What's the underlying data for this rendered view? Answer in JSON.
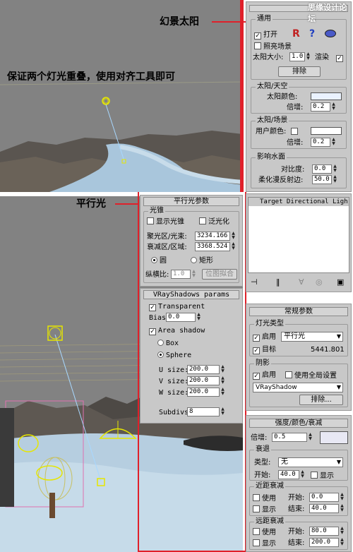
{
  "watermark": "思缘设计论坛",
  "callouts": {
    "sun": "幻景太阳",
    "align_note": "保证两个灯光重叠，使用对齐工具即可",
    "parallel": "平行光"
  },
  "sun_panel": {
    "common_title": "通用",
    "on_label": "打开",
    "exclude_lighting": "照亮场景",
    "sun_size_label": "太阳大小:",
    "sun_size_value": "1.0",
    "render_label": "渲染",
    "exclude_button": "排除",
    "sky_title": "太阳/天空",
    "sun_color_label": "太阳颜色:",
    "mult_label": "倍增:",
    "sun_mult": "0.2",
    "scene_title": "太阳/场景",
    "user_color_label": "用户颜色:",
    "scene_mult": "0.2",
    "water_title": "影响水面",
    "contrast_label": "对比度:",
    "contrast_value": "0.0",
    "diffuse_label": "柔化漫反射边:",
    "diffuse_value": "50.0"
  },
  "directional_panel": {
    "title": "平行光参数",
    "cone_group": "光锥",
    "show_cone": "显示光锥",
    "overshoot": "泛光化",
    "hotspot_label": "聚光区/光束:",
    "hotspot_value": "3234.166",
    "falloff_label": "衰减区/区域:",
    "falloff_value": "3368.524",
    "circle": "圆",
    "rect": "矩形",
    "aspect_label": "纵横比:",
    "aspect_value": "1.0",
    "bitmap_fit": "位图拟合"
  },
  "vray_panel": {
    "title": "VRayShadows params",
    "transparent": "Transparent",
    "bias_label": "Bias:",
    "bias_value": "0.0",
    "area_shadow": "Area shadow",
    "box": "Box",
    "sphere": "Sphere",
    "usize_label": "U size:",
    "usize": "200.0",
    "vsize_label": "V size:",
    "vsize": "200.0",
    "wsize_label": "W size:",
    "wsize": "200.0",
    "subdivs_label": "Subdivs:",
    "subdivs": "8"
  },
  "list_panel": {
    "item": "Target Directional Ligh"
  },
  "general_panel": {
    "title": "常规参数",
    "light_type_group": "灯光类型",
    "enable_label": "启用",
    "type_value": "平行光",
    "target_label": "目标",
    "target_value": "5441.801",
    "shadow_group": "阴影",
    "shadow_enable": "启用",
    "global_settings": "使用全局设置",
    "shadow_type": "VRayShadow",
    "exclude_button": "排除..."
  },
  "intensity_panel": {
    "title": "强度/颜色/衰减",
    "mult_label": "倍增:",
    "mult_value": "0.5",
    "decay_group": "衰退",
    "type_label": "类型:",
    "type_value": "无",
    "start_label": "开始:",
    "start_value": "40.0",
    "show_label": "显示",
    "near_group": "近距衰减",
    "use_label": "使用",
    "near_start": "0.0",
    "near_start_label": "开始:",
    "near_end_label": "结束:",
    "near_end": "40.0",
    "far_group": "远距衰减",
    "far_start": "80.0",
    "far_end": "200.0"
  },
  "colors": {
    "highlight_border": "#e0202a",
    "sun_color": "#eaf2ff",
    "panel_bg": "#c8c8c8"
  }
}
